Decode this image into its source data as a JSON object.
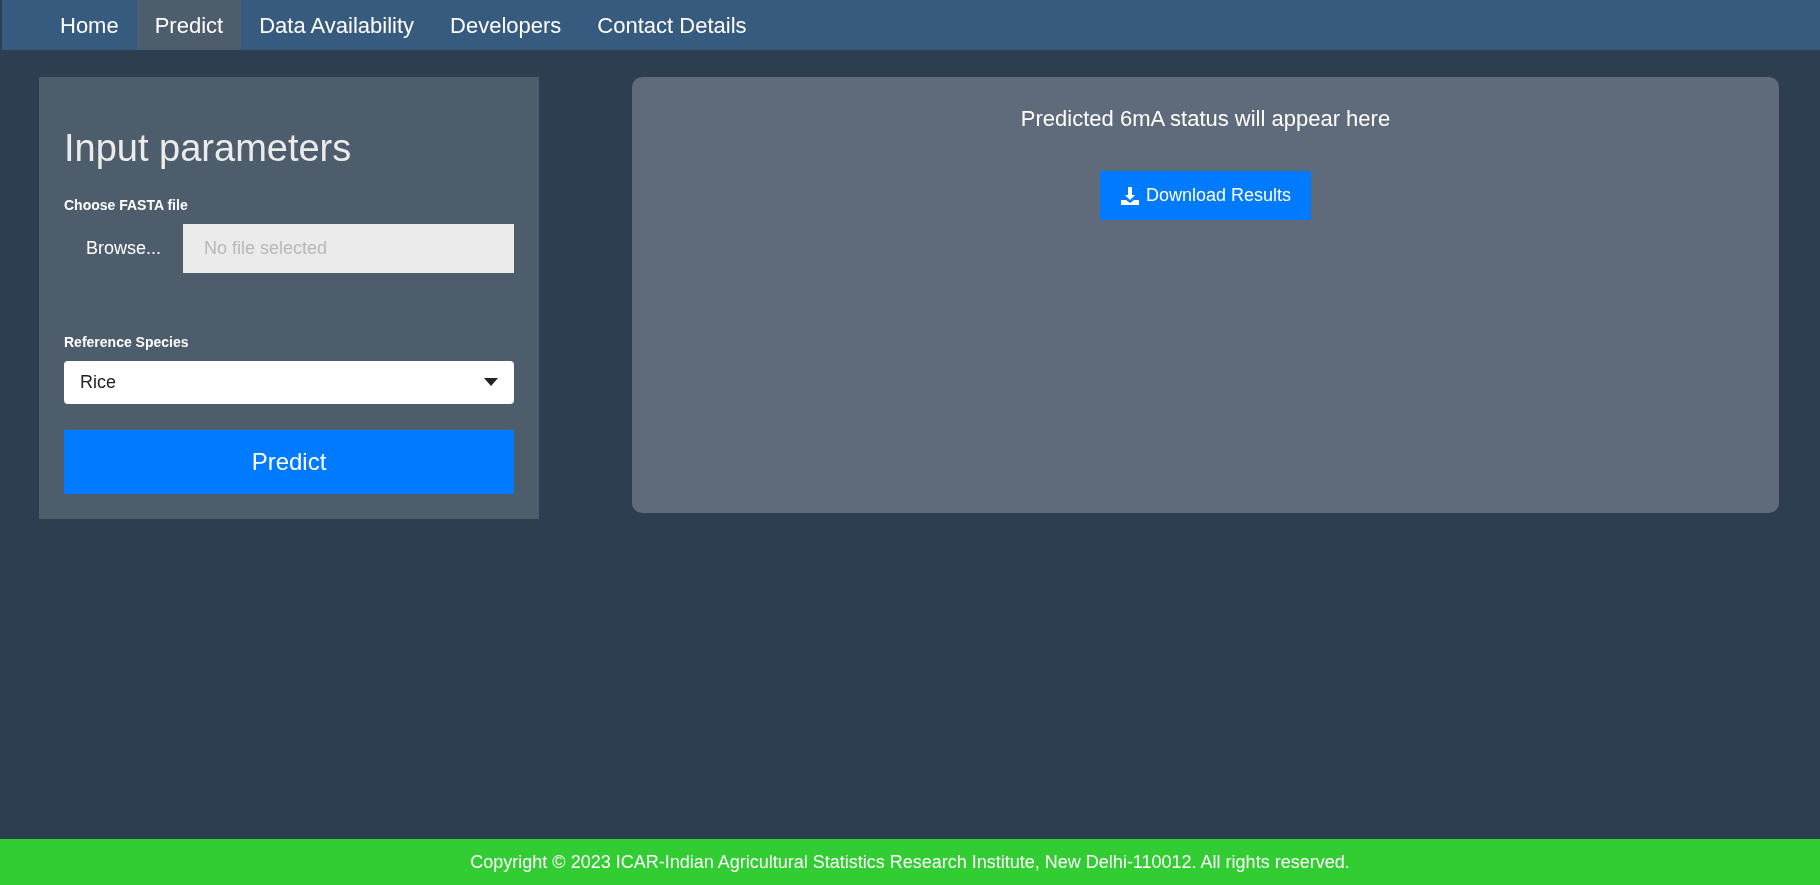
{
  "nav": [
    {
      "label": "Home",
      "selected": false
    },
    {
      "label": "Predict",
      "selected": true
    },
    {
      "label": "Data Availability",
      "selected": false
    },
    {
      "label": "Developers",
      "selected": false
    },
    {
      "label": "Contact Details",
      "selected": false
    }
  ],
  "input_panel": {
    "title": "Input parameters",
    "file_label": "Choose FASTA file",
    "browse_button": "Browse...",
    "file_placeholder": "No file selected",
    "species_label": "Reference Species",
    "species_value": "Rice",
    "predict_button": "Predict"
  },
  "output_panel": {
    "message": "Predicted 6mA status will appear here",
    "download_button": "Download Results"
  },
  "footer": "Copyright © 2023 ICAR-Indian Agricultural Statistics Research Institute, New Delhi-110012. All rights reserved."
}
